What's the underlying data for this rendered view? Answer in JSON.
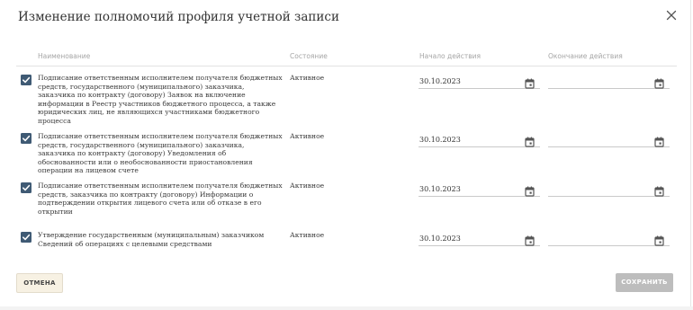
{
  "dialog": {
    "title": "Изменение полномочий профиля учетной записи",
    "close_icon": "close-icon"
  },
  "table": {
    "columns": {
      "name": "Наименование",
      "state": "Состояние",
      "start": "Начало действия",
      "end": "Окончание действия"
    },
    "rows": [
      {
        "checked": true,
        "name": "Подписание ответственным исполнителем получателя бюджетных средств, государственного (муниципального) заказчика, заказчика по контракту (договору) Заявок на включение информации в Реестр участников бюджетного процесса, а также юридических лиц, не являющихся участниками бюджетного процесса",
        "state": "Активное",
        "start_date": "30.10.2023",
        "end_date": ""
      },
      {
        "checked": true,
        "name": "Подписание ответственным исполнителем получателя бюджетных средств, государственного (муниципального) заказчика, заказчика по контракту (договору) Уведомления об обоснованности или о необоснованности приостановления операции на лицевом счете",
        "state": "Активное",
        "start_date": "30.10.2023",
        "end_date": ""
      },
      {
        "checked": true,
        "name": "Подписание ответственным исполнителем получателя бюджетных средств, заказчика по контракту (договору) Информации о подтверждении открытия лицевого счета или об отказе в его открытии",
        "state": "Активное",
        "start_date": "30.10.2023",
        "end_date": ""
      },
      {
        "checked": true,
        "name": "Утверждение государственным (муниципальным) заказчиком Сведений об операциях с целевыми средствами",
        "state": "Активное",
        "start_date": "30.10.2023",
        "end_date": ""
      }
    ]
  },
  "footer": {
    "cancel_label": "ОТМЕНА",
    "save_label": "СОХРАНИТЬ"
  },
  "colors": {
    "checkbox": "#3f5a74",
    "cancel_bg": "#f7f1e3",
    "save_bg_disabled": "#bdbdbd"
  }
}
